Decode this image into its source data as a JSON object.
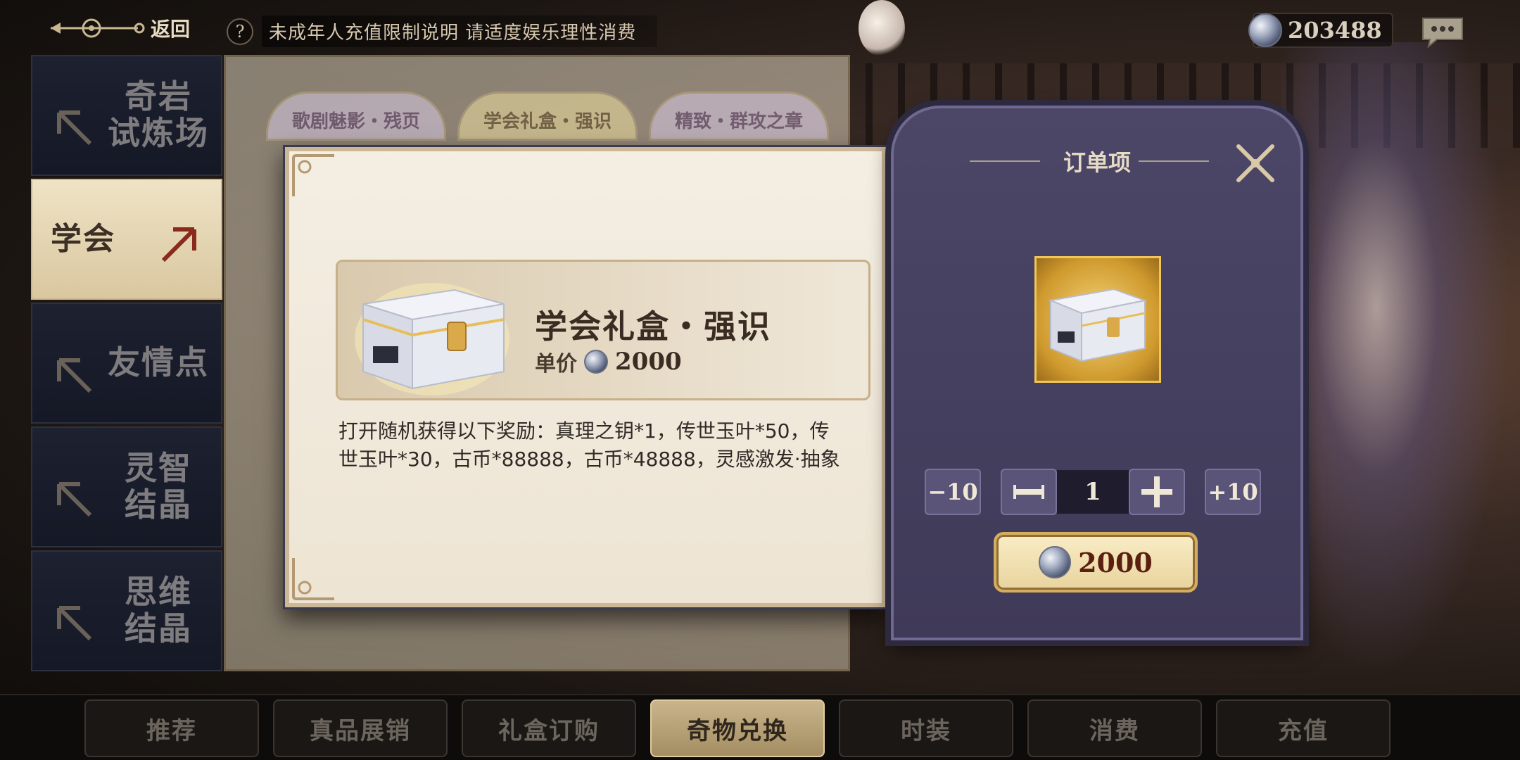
{
  "topbar": {
    "back_label": "返回",
    "help_icon": "?",
    "notice_text": "未成年人充值限制说明  请适度娱乐理性消费",
    "currency_value": "203488"
  },
  "sidebar": {
    "items": [
      {
        "label": "奇岩\n试炼场",
        "active": false
      },
      {
        "label": "学会",
        "active": true
      },
      {
        "label": "友情点",
        "active": false
      },
      {
        "label": "灵智\n结晶",
        "active": false
      },
      {
        "label": "思维\n结晶",
        "active": false
      }
    ]
  },
  "board": {
    "tabs": [
      "歌剧魅影・残页",
      "学会礼盒・强识",
      "精致・群攻之章"
    ]
  },
  "item": {
    "name": "学会礼盒・强识",
    "price_label": "单价",
    "price_value": "2000",
    "description": "打开随机获得以下奖励：真理之钥*1，传世玉叶*50，传世玉叶*30，古币*88888，古币*48888，灵感激发·抽象"
  },
  "order": {
    "title": "订单项",
    "minus10_label": "−10",
    "plus10_label": "+10",
    "quantity": "1",
    "total": "2000"
  },
  "bottom_tabs": [
    {
      "label": "推荐",
      "active": false
    },
    {
      "label": "真品展销",
      "active": false
    },
    {
      "label": "礼盒订购",
      "active": false
    },
    {
      "label": "奇物兑换",
      "active": true
    },
    {
      "label": "时装",
      "active": false
    },
    {
      "label": "消费",
      "active": false
    },
    {
      "label": "充值",
      "active": false
    }
  ],
  "colors": {
    "panel_purple": "#4c4667",
    "gold_accent": "#d4ad5e",
    "price_red": "#5a1f10"
  }
}
